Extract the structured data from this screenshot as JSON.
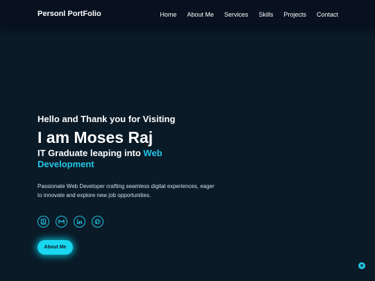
{
  "header": {
    "brand": "Personl PortFolio",
    "nav": [
      {
        "label": "Home"
      },
      {
        "label": "About Me"
      },
      {
        "label": "Services"
      },
      {
        "label": "Skills"
      },
      {
        "label": "Projects"
      },
      {
        "label": "Contact"
      }
    ]
  },
  "hero": {
    "greeting": "Hello and Thank you for Visiting",
    "name": "I am Moses Raj",
    "role_prefix": "IT Graduate leaping into ",
    "role_accent": "Web Development",
    "description": "Passionate Web Developer crafting seamless digital experiences, eager to innovate and explore new job opportunities.",
    "socials": [
      {
        "icon": "resume-icon"
      },
      {
        "icon": "gmail-icon"
      },
      {
        "icon": "linkedin-icon"
      },
      {
        "icon": "github-icon"
      }
    ],
    "button_label": "About Me"
  },
  "colors": {
    "background": "#0a1a27",
    "navbar": "#07111f",
    "accent": "#22c7e6",
    "button": "#1ad7f0"
  },
  "scroll_top_icon": "arrow-up-icon"
}
